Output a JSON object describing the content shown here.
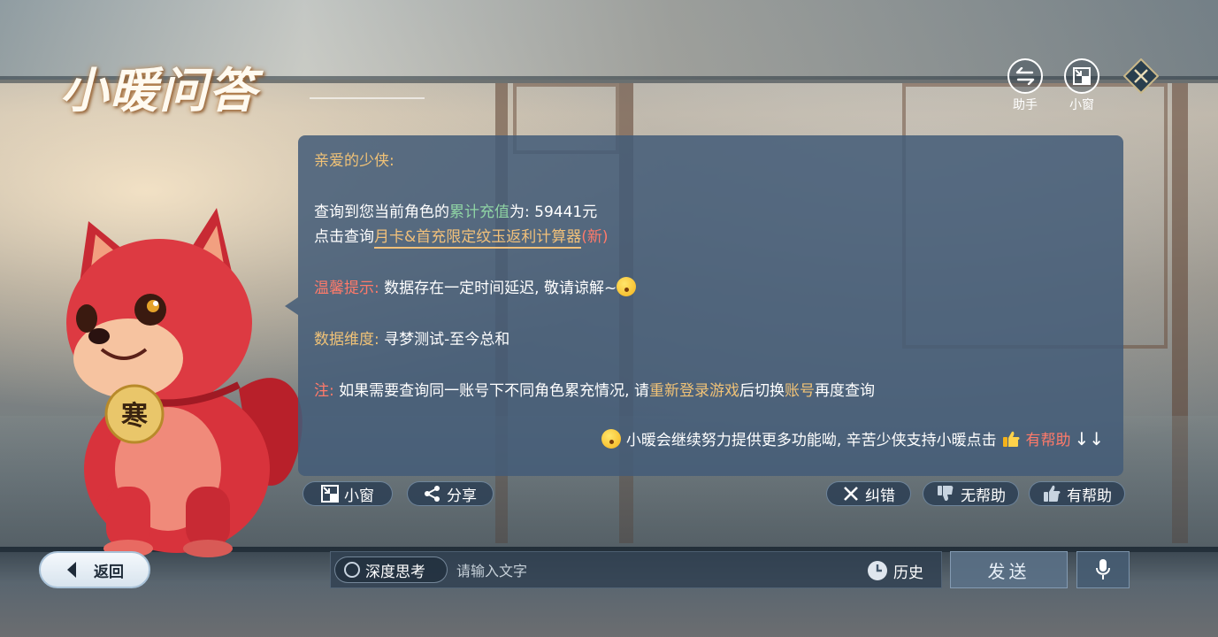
{
  "header": {
    "title": "小暖问答",
    "assistant_label": "助手",
    "mini_window_label": "小窗"
  },
  "dialog": {
    "greeting": "亲爱的少侠:",
    "line1_prefix": "查询到您当前角色的",
    "line1_highlight": "累计充值",
    "line1_suffix": "为: 59441元",
    "line2_prefix": "点击查询",
    "line2_link": "月卡&首充限定纹玉返利计算器",
    "line2_new": "(新)",
    "tip_label": "温馨提示:",
    "tip_text": " 数据存在一定时间延迟, 敬请谅解~",
    "dimension_label": "数据维度:",
    "dimension_text": " 寻梦测试-至今总和",
    "note_label": "注:",
    "note_text1": " 如果需要查询同一账号下不同角色累充情况, 请",
    "note_highlight1": "重新登录游戏",
    "note_text2": "后切换",
    "note_highlight2": "账号",
    "note_text3": "再度查询",
    "footer_text": "小暖会继续努力提供更多功能呦, 辛苦少侠支持小暖点击",
    "footer_helpful": "有帮助",
    "footer_arrows": "↓↓"
  },
  "actions": {
    "mini_window": "小窗",
    "share": "分享",
    "correct": "纠错",
    "not_helpful": "无帮助",
    "helpful": "有帮助"
  },
  "bottom": {
    "back": "返回",
    "deep_think": "深度思考",
    "input_placeholder": "请输入文字",
    "history": "历史",
    "send": "发送"
  },
  "mascot": {
    "tag_text": "寒"
  },
  "colors": {
    "gold": "#f0c277",
    "green": "#8fd4a4",
    "red": "#ff7a6a",
    "dialog_bg": "#445c78"
  }
}
